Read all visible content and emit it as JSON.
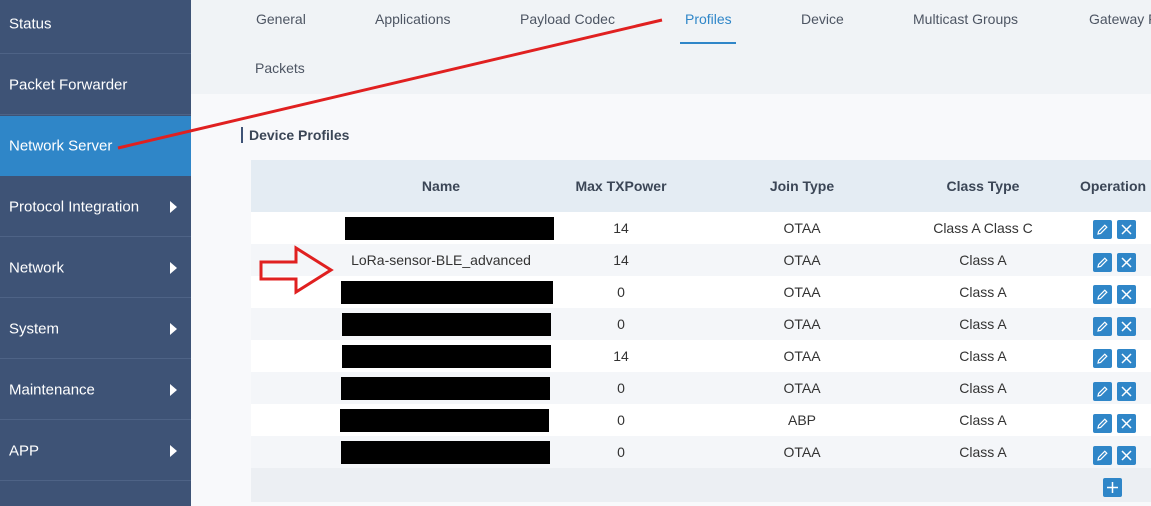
{
  "sidebar": {
    "items": [
      {
        "label": "Status"
      },
      {
        "label": "Packet Forwarder"
      },
      {
        "label": "Network Server"
      },
      {
        "label": "Protocol Integration"
      },
      {
        "label": "Network"
      },
      {
        "label": "System"
      },
      {
        "label": "Maintenance"
      },
      {
        "label": "APP"
      }
    ]
  },
  "tabs": [
    {
      "label": "General"
    },
    {
      "label": "Applications"
    },
    {
      "label": "Payload Codec"
    },
    {
      "label": "Profiles"
    },
    {
      "label": "Device"
    },
    {
      "label": "Multicast Groups"
    },
    {
      "label": "Gateway F"
    },
    {
      "label": "Packets"
    }
  ],
  "section": {
    "title": "Device Profiles"
  },
  "table": {
    "headers": {
      "name": "Name",
      "max_tx": "Max TXPower",
      "join": "Join Type",
      "class": "Class Type",
      "operation": "Operation"
    },
    "rows": [
      {
        "name": "",
        "max_tx": "14",
        "join": "OTAA",
        "class": "Class A Class C"
      },
      {
        "name": "LoRa-sensor-BLE_advanced",
        "max_tx": "14",
        "join": "OTAA",
        "class": "Class A"
      },
      {
        "name": "",
        "max_tx": "0",
        "join": "OTAA",
        "class": "Class A"
      },
      {
        "name": "",
        "max_tx": "0",
        "join": "OTAA",
        "class": "Class A"
      },
      {
        "name": "",
        "max_tx": "14",
        "join": "OTAA",
        "class": "Class A"
      },
      {
        "name": "",
        "max_tx": "0",
        "join": "OTAA",
        "class": "Class A"
      },
      {
        "name": "",
        "max_tx": "0",
        "join": "ABP",
        "class": "Class A"
      },
      {
        "name": "",
        "max_tx": "0",
        "join": "OTAA",
        "class": "Class A"
      }
    ]
  },
  "colors": {
    "accent": "#2f86c8",
    "sidebar": "#3e5376",
    "annotation": "#e02020"
  },
  "icons": {
    "edit": "pencil-icon",
    "delete": "close-icon",
    "add": "plus-icon",
    "submenu": "caret-right-icon"
  }
}
